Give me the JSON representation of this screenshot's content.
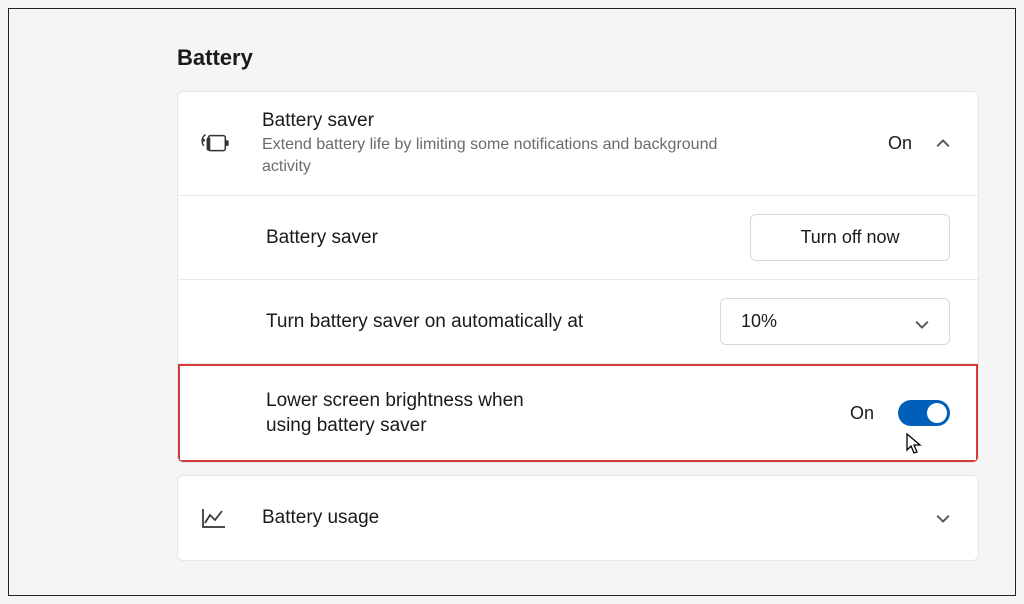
{
  "section": {
    "title": "Battery"
  },
  "battery_saver": {
    "header": {
      "title": "Battery saver",
      "description": "Extend battery life by limiting some notifications and background activity",
      "status": "On"
    },
    "turn_off": {
      "label": "Battery saver",
      "button": "Turn off now"
    },
    "auto_on": {
      "label": "Turn battery saver on automatically at",
      "value": "10%"
    },
    "brightness": {
      "label_line1": "Lower screen brightness when",
      "label_line2": "using battery saver",
      "status": "On",
      "toggle_on": true
    }
  },
  "battery_usage": {
    "title": "Battery usage"
  }
}
